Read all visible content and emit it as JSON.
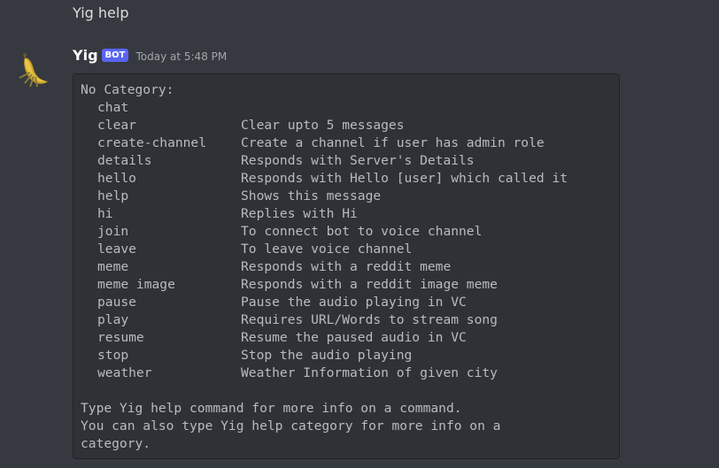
{
  "previous_message": {
    "text": "Yig help"
  },
  "message": {
    "author": "Yig",
    "bot_tag": "BOT",
    "timestamp": "Today at 5:48 PM",
    "avatar_icon": "banana-avatar-icon"
  },
  "help": {
    "category_title": "No Category:",
    "commands": [
      {
        "name": "chat",
        "description": ""
      },
      {
        "name": "clear",
        "description": "Clear upto 5 messages"
      },
      {
        "name": "create-channel",
        "description": "Create a channel if user has admin role"
      },
      {
        "name": "details",
        "description": "Responds with Server's Details"
      },
      {
        "name": "hello",
        "description": "Responds with Hello [user] which called it"
      },
      {
        "name": "help",
        "description": "Shows this message"
      },
      {
        "name": "hi",
        "description": "Replies with Hi"
      },
      {
        "name": "join",
        "description": "To connect bot to voice channel"
      },
      {
        "name": "leave",
        "description": "To leave voice channel"
      },
      {
        "name": "meme",
        "description": "Responds with a reddit meme"
      },
      {
        "name": "meme image",
        "description": "Responds with a reddit image meme"
      },
      {
        "name": "pause",
        "description": "Pause the audio playing in VC"
      },
      {
        "name": "play",
        "description": "Requires URL/Words to stream song"
      },
      {
        "name": "resume",
        "description": "Resume the paused audio in VC"
      },
      {
        "name": "stop",
        "description": "Stop the audio playing"
      },
      {
        "name": "weather",
        "description": "Weather Information of given city"
      }
    ],
    "footer_line_1": "Type Yig help command for more info on a command.",
    "footer_line_2": "You can also type Yig help category for more info on a",
    "footer_line_3": "category."
  },
  "colors": {
    "background": "#36393f",
    "codeblock_background": "#2f3136",
    "bot_tag": "#5865f2"
  }
}
